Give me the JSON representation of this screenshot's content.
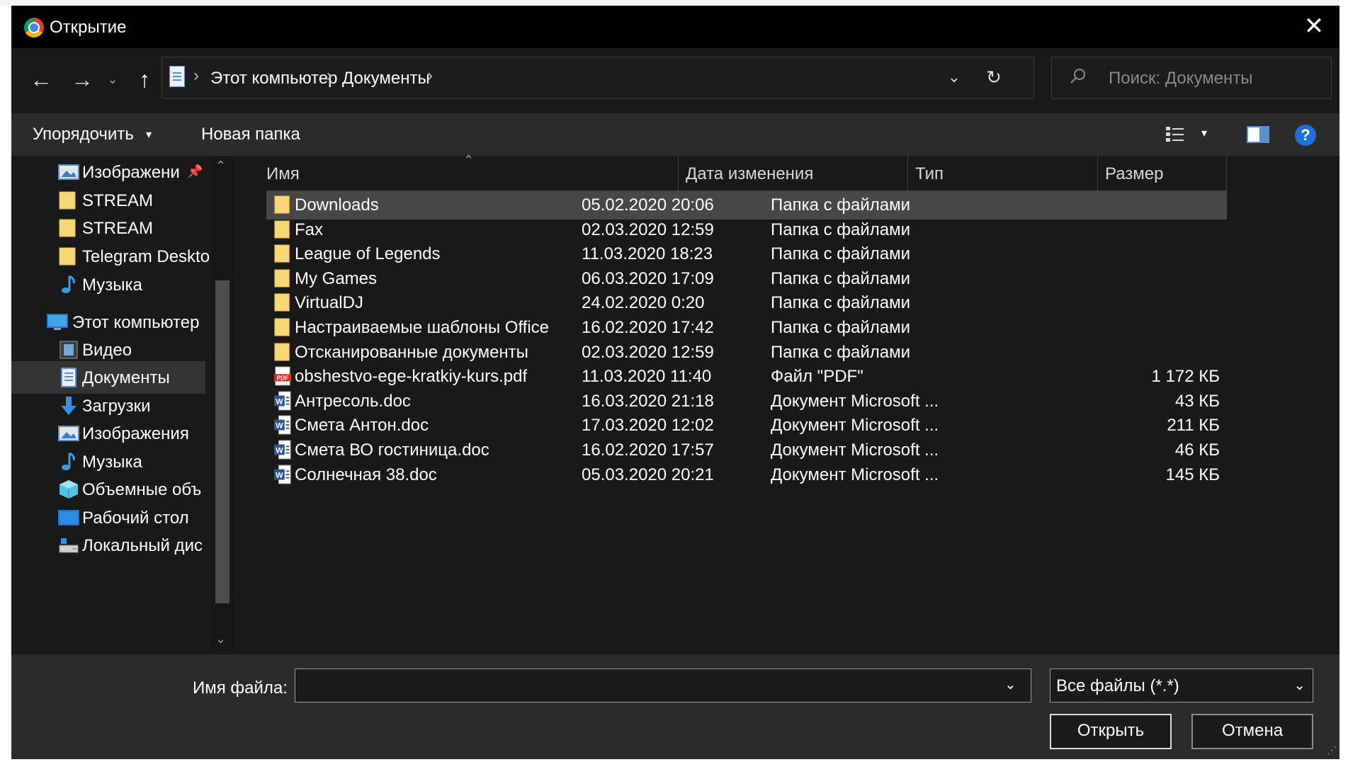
{
  "window": {
    "title": "Открытие",
    "close_label": "✕"
  },
  "nav": {
    "back_icon": "arrow-left",
    "forward_icon": "arrow-right",
    "history_icon": "chevron-down",
    "up_icon": "arrow-up",
    "breadcrumbs": [
      "Этот компьютер",
      "Документы"
    ],
    "separator": "›",
    "refresh_icon": "refresh"
  },
  "search": {
    "placeholder": "Поиск: Документы"
  },
  "toolbar": {
    "organize_label": "Упорядочить",
    "organize_arrow": "▾",
    "new_folder_label": "Новая папка",
    "view_drop": "▾",
    "help_label": "?"
  },
  "sidebar": {
    "items": [
      {
        "label": "Изображени",
        "icon": "pictures",
        "pinned": true
      },
      {
        "label": "STREAM",
        "icon": "folder"
      },
      {
        "label": "STREAM",
        "icon": "folder"
      },
      {
        "label": "Telegram Deskto",
        "icon": "folder"
      },
      {
        "label": "Музыка",
        "icon": "music"
      },
      {
        "label": "Этот компьютер",
        "icon": "computer"
      },
      {
        "label": "Видео",
        "icon": "video"
      },
      {
        "label": "Документы",
        "icon": "documents",
        "selected": true
      },
      {
        "label": "Загрузки",
        "icon": "downloads"
      },
      {
        "label": "Изображения",
        "icon": "pictures"
      },
      {
        "label": "Музыка",
        "icon": "music"
      },
      {
        "label": "Объемные объ",
        "icon": "3d-objects"
      },
      {
        "label": "Рабочий стол",
        "icon": "desktop"
      },
      {
        "label": "Локальный дис",
        "icon": "drive"
      }
    ]
  },
  "columns": {
    "name": "Имя",
    "date": "Дата изменения",
    "type": "Тип",
    "size": "Размер"
  },
  "files": [
    {
      "name": "Downloads",
      "date": "05.02.2020 20:06",
      "type": "Папка с файлами",
      "size": "",
      "icon": "folder"
    },
    {
      "name": "Fax",
      "date": "02.03.2020 12:59",
      "type": "Папка с файлами",
      "size": "",
      "icon": "folder"
    },
    {
      "name": "League of Legends",
      "date": "11.03.2020 18:23",
      "type": "Папка с файлами",
      "size": "",
      "icon": "folder"
    },
    {
      "name": "My Games",
      "date": "06.03.2020 17:09",
      "type": "Папка с файлами",
      "size": "",
      "icon": "folder"
    },
    {
      "name": "VirtualDJ",
      "date": "24.02.2020 0:20",
      "type": "Папка с файлами",
      "size": "",
      "icon": "folder"
    },
    {
      "name": "Настраиваемые шаблоны Office",
      "date": "16.02.2020 17:42",
      "type": "Папка с файлами",
      "size": "",
      "icon": "folder"
    },
    {
      "name": "Отсканированные документы",
      "date": "02.03.2020 12:59",
      "type": "Папка с файлами",
      "size": "",
      "icon": "folder"
    },
    {
      "name": "obshestvo-ege-kratkiy-kurs.pdf",
      "date": "11.03.2020 11:40",
      "type": "Файл \"PDF\"",
      "size": "1 172 КБ",
      "icon": "pdf"
    },
    {
      "name": "Антресоль.doc",
      "date": "16.03.2020 21:18",
      "type": "Документ Microsoft ...",
      "size": "43 КБ",
      "icon": "word"
    },
    {
      "name": "Смета Антон.doc",
      "date": "17.03.2020 12:02",
      "type": "Документ Microsoft ...",
      "size": "211 КБ",
      "icon": "word"
    },
    {
      "name": "Смета ВО гостиница.doc",
      "date": "16.02.2020 17:57",
      "type": "Документ Microsoft ...",
      "size": "46 КБ",
      "icon": "word"
    },
    {
      "name": "Солнечная 38.doc",
      "date": "05.03.2020 20:21",
      "type": "Документ Microsoft ...",
      "size": "145 КБ",
      "icon": "word"
    }
  ],
  "footer": {
    "filename_label": "Имя файла:",
    "filename_value": "",
    "filter_value": "Все файлы (*.*)",
    "open_label": "Открыть",
    "cancel_label": "Отмена"
  },
  "colors": {
    "window_bg": "#191919",
    "toolbar_bg": "#2b2b2b",
    "selected_row": "#474747",
    "accent": "#1e6fd9"
  }
}
